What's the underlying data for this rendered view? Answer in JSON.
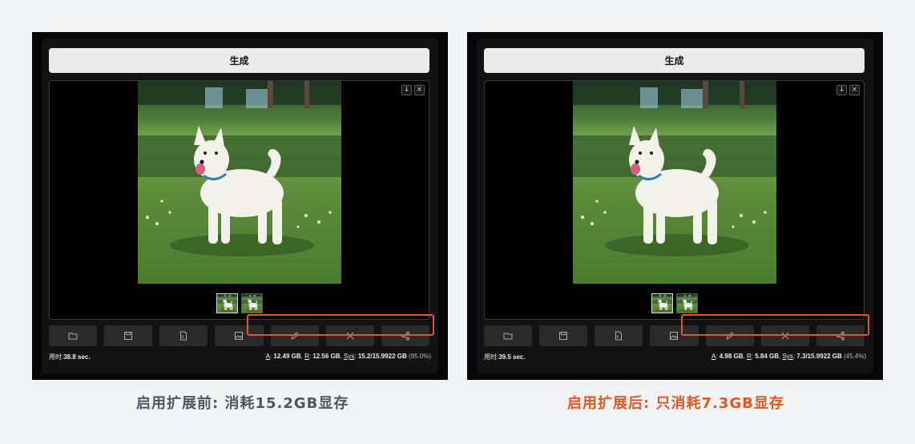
{
  "left": {
    "generate_label": "生成",
    "time_label": "用时:",
    "time_value": "38.8 sec.",
    "mem_a_label": "A",
    "mem_a_value": "12.49 GB",
    "mem_r_label": "R",
    "mem_r_value": "12.56 GB",
    "mem_sys_label": "Sys",
    "mem_sys_value": "15.2/15.9922 GB",
    "mem_pct": "(95.0%)",
    "caption": "启用扩展前: 消耗15.2GB显存"
  },
  "right": {
    "generate_label": "生成",
    "time_label": "用时:",
    "time_value": "39.5 sec.",
    "mem_a_label": "A",
    "mem_a_value": "4.98 GB",
    "mem_r_label": "R",
    "mem_r_value": "5.84 GB",
    "mem_sys_label": "Sys",
    "mem_sys_value": "7.3/15.9922 GB",
    "mem_pct": "(45.4%)",
    "caption": "启用扩展后: 只消耗7.3GB显存"
  },
  "icons": {
    "download": "download-icon",
    "close": "close-icon",
    "toolbar": [
      "folder-icon",
      "save-icon",
      "zip-icon",
      "image-icon",
      "pencil-icon",
      "tools-icon",
      "share-icon"
    ]
  },
  "colors": {
    "highlight": "#e7561f",
    "caption_left": "#4f5663",
    "caption_right": "#e7561f",
    "panel_bg": "#070707"
  }
}
